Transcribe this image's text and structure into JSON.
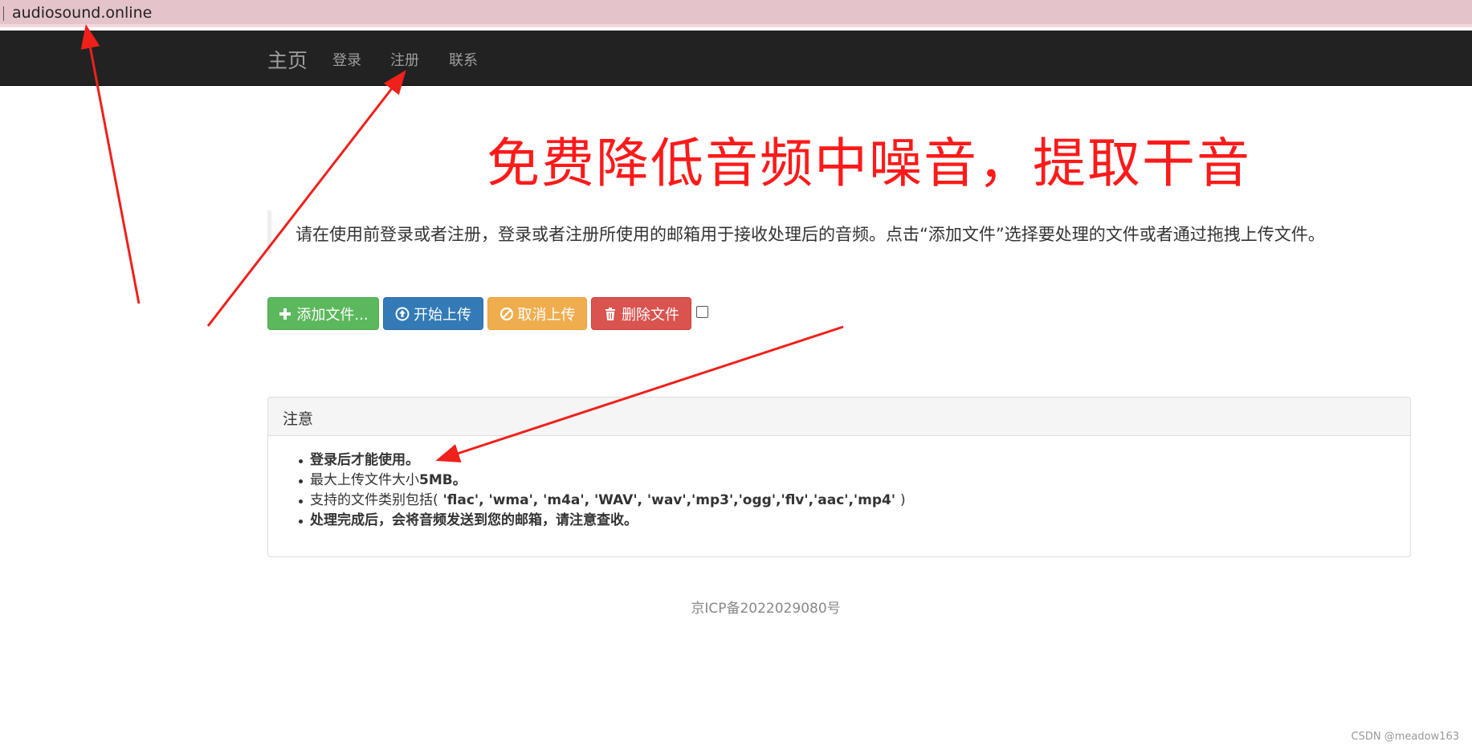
{
  "browser": {
    "url": "audiosound.online"
  },
  "navbar": {
    "brand": "主页",
    "links": [
      "登录",
      "注册",
      "联系"
    ]
  },
  "hero": {
    "title": "免费降低音频中噪音，提取干音"
  },
  "intro": {
    "text": "请在使用前登录或者注册，登录或者注册所使用的邮箱用于接收处理后的音频。点击“添加文件”选择要处理的文件或者通过拖拽上传文件。"
  },
  "toolbar": {
    "add_label": "添加文件...",
    "upload_label": "开始上传",
    "cancel_label": "取消上传",
    "delete_label": "删除文件"
  },
  "notice": {
    "title": "注意",
    "item1": "登录后才能使用。",
    "item2_prefix": "最大上传文件大小",
    "item2_bold": "5MB。",
    "item3_prefix": "支持的文件类别包括(",
    "item3_formats": " 'flac', 'wma', 'm4a', 'WAV', 'wav','mp3','ogg','flv','aac','mp4' ",
    "item3_suffix": ")",
    "item4": "处理完成后，会将音频发送到您的邮箱，请注意查收。"
  },
  "footer": {
    "icp": "京ICP备2022029080号"
  },
  "watermark": "CSDN @meadow163",
  "colors": {
    "navbar_bg": "#222222",
    "title_red": "#ff1a1a",
    "btn_success": "#5cb85c",
    "btn_primary": "#337ab7",
    "btn_warning": "#f0ad4e",
    "btn_danger": "#d9534f",
    "annotation_arrow": "#f0201a"
  }
}
